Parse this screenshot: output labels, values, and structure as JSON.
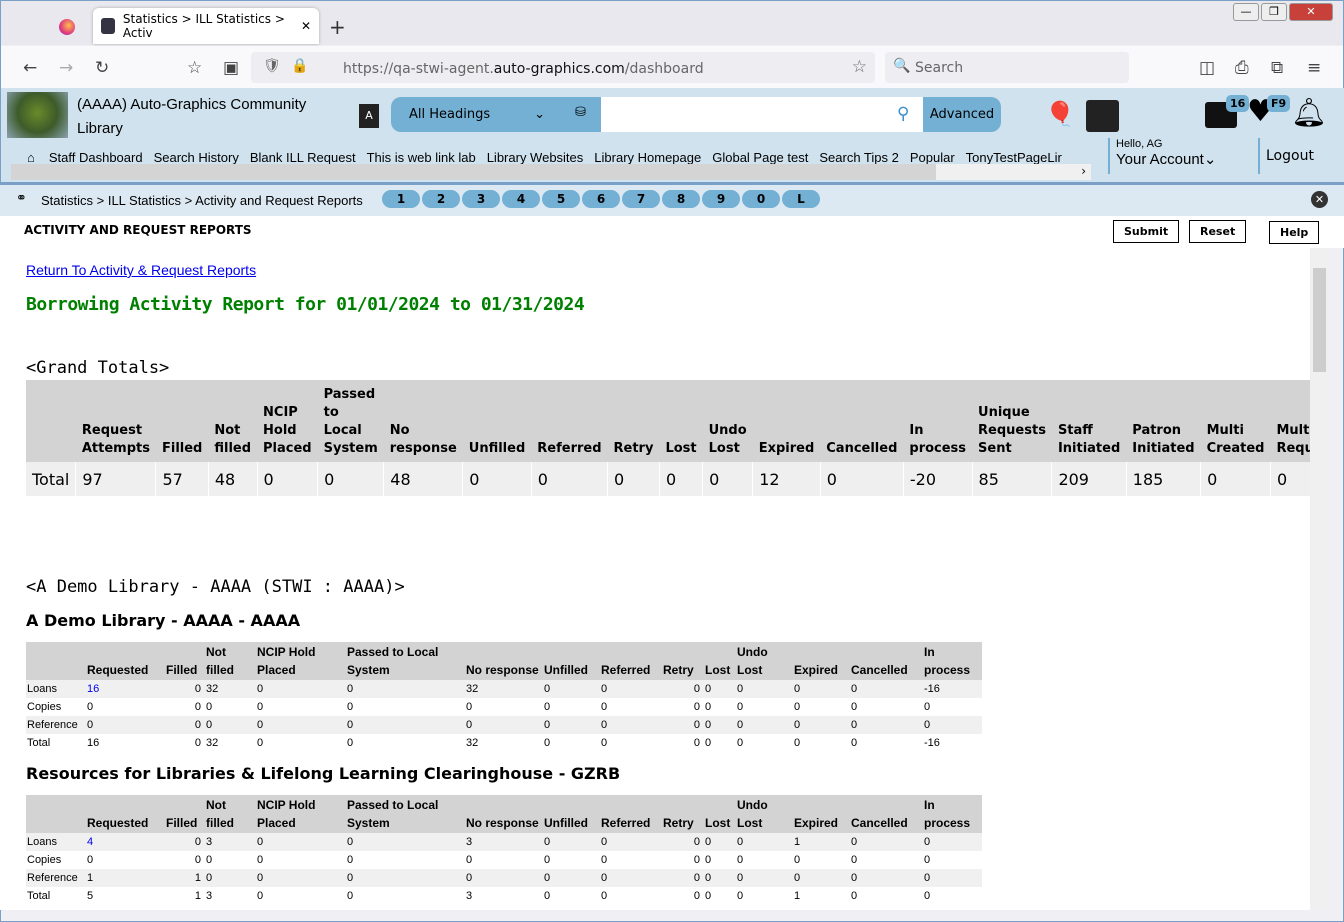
{
  "browser": {
    "tab_title": "Statistics > ILL Statistics > Activ",
    "url_prefix": "https://qa-stwi-agent.",
    "url_domain": "auto-graphics.com",
    "url_path": "/dashboard",
    "search_placeholder": "Search"
  },
  "header": {
    "library_name": "(AAAA) Auto-Graphics Community Library",
    "search_scope": "All Headings",
    "advanced_label": "Advanced",
    "badge_list": "16",
    "badge_fav": "F9",
    "greeting": "Hello, AG",
    "account_label": "Your Account",
    "logout_label": "Logout"
  },
  "menu": [
    "Staff Dashboard",
    "Search History",
    "Blank ILL Request",
    "This is web link lab",
    "Library Websites",
    "Library Homepage",
    "Global Page test",
    "Search Tips 2",
    "Popular",
    "TonyTestPageLir"
  ],
  "breadcrumb": "Statistics > ILL Statistics > Activity and Request Reports",
  "pages": [
    "1",
    "2",
    "3",
    "4",
    "5",
    "6",
    "7",
    "8",
    "9",
    "0",
    "L"
  ],
  "page_title": "ACTIVITY AND REQUEST REPORTS",
  "buttons": {
    "submit": "Submit",
    "reset": "Reset",
    "help": "Help"
  },
  "back_link": "Return To Activity & Request Reports",
  "report_title": "Borrowing Activity Report for 01/01/2024 to 01/31/2024",
  "grand": {
    "heading": "<Grand Totals>",
    "columns": [
      "",
      "Request Attempts",
      "Filled",
      "Not filled",
      "NCIP Hold Placed",
      "Passed to Local System",
      "No response",
      "Unfilled",
      "Referred",
      "Retry",
      "Lost",
      "Undo Lost",
      "Expired",
      "Cancelled",
      "In process",
      "Unique Requests Sent",
      "Staff Initiated",
      "Patron Initiated",
      "Multi Created",
      "Multi Requests"
    ],
    "row": [
      "Total",
      "97",
      "57",
      "48",
      "0",
      "0",
      "48",
      "0",
      "0",
      "0",
      "0",
      "0",
      "12",
      "0",
      "-20",
      "85",
      "209",
      "185",
      "0",
      "0"
    ]
  },
  "group_heading": "<A Demo Library - AAAA (STWI : AAAA)>",
  "sub_columns": [
    "",
    "Requested",
    "Filled",
    "Not filled",
    "NCIP Hold Placed",
    "Passed to Local System",
    "No response",
    "Unfilled",
    "Referred",
    "Retry",
    "Lost",
    "Undo Lost",
    "Expired",
    "Cancelled",
    "In process"
  ],
  "libraries": [
    {
      "name": "A Demo Library - AAAA - AAAA",
      "rows": [
        [
          "Loans",
          "16",
          "0",
          "32",
          "0",
          "0",
          "32",
          "0",
          "0",
          "0",
          "0",
          "0",
          "0",
          "0",
          "-16"
        ],
        [
          "Copies",
          "0",
          "0",
          "0",
          "0",
          "0",
          "0",
          "0",
          "0",
          "0",
          "0",
          "0",
          "0",
          "0",
          "0"
        ],
        [
          "Reference",
          "0",
          "0",
          "0",
          "0",
          "0",
          "0",
          "0",
          "0",
          "0",
          "0",
          "0",
          "0",
          "0",
          "0"
        ],
        [
          "Total",
          "16",
          "0",
          "32",
          "0",
          "0",
          "32",
          "0",
          "0",
          "0",
          "0",
          "0",
          "0",
          "0",
          "-16"
        ]
      ]
    },
    {
      "name": "Resources for Libraries & Lifelong Learning Clearinghouse - GZRB",
      "rows": [
        [
          "Loans",
          "4",
          "0",
          "3",
          "0",
          "0",
          "3",
          "0",
          "0",
          "0",
          "0",
          "0",
          "1",
          "0",
          "0"
        ],
        [
          "Copies",
          "0",
          "0",
          "0",
          "0",
          "0",
          "0",
          "0",
          "0",
          "0",
          "0",
          "0",
          "0",
          "0",
          "0"
        ],
        [
          "Reference",
          "1",
          "1",
          "0",
          "0",
          "0",
          "0",
          "0",
          "0",
          "0",
          "0",
          "0",
          "0",
          "0",
          "0"
        ],
        [
          "Total",
          "5",
          "1",
          "3",
          "0",
          "0",
          "3",
          "0",
          "0",
          "0",
          "0",
          "0",
          "1",
          "0",
          "0"
        ]
      ]
    }
  ]
}
